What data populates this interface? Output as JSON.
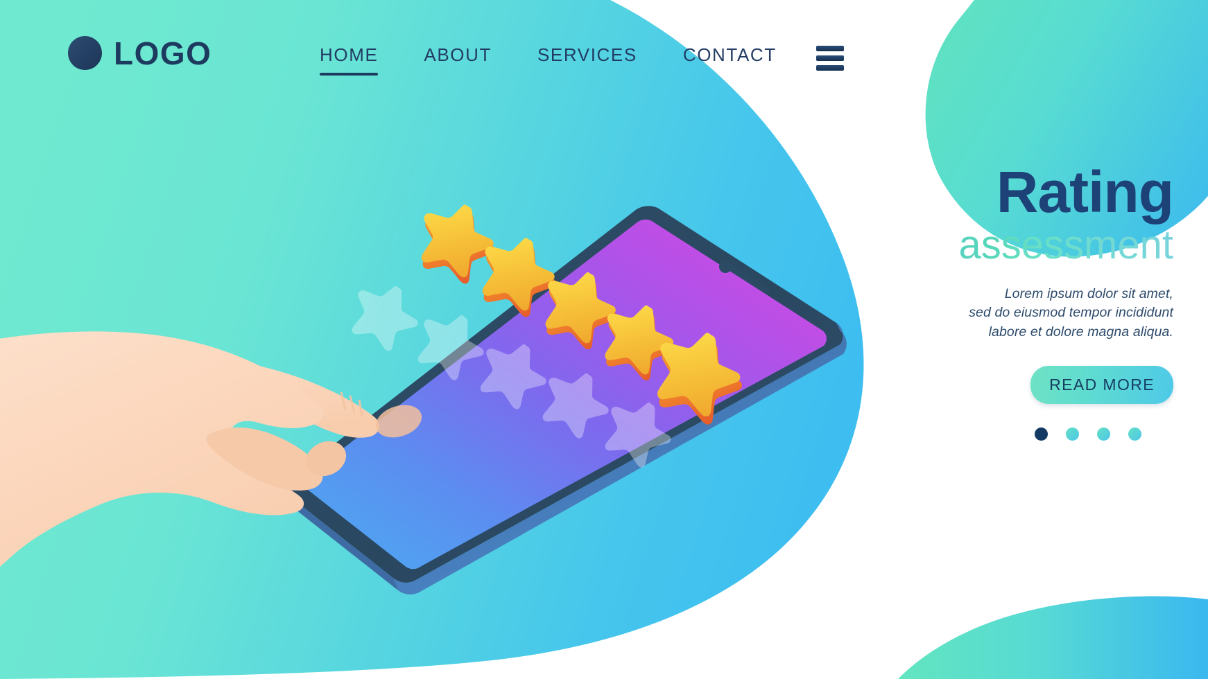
{
  "brand": {
    "logo_icon": "circle-logo-mark",
    "name": "LOGO"
  },
  "nav": {
    "items": [
      {
        "label": "HOME",
        "active": true
      },
      {
        "label": "ABOUT",
        "active": false
      },
      {
        "label": "SERVICES",
        "active": false
      },
      {
        "label": "CONTACT",
        "active": false
      }
    ],
    "menu_icon": "hamburger-menu-icon"
  },
  "hero": {
    "title": "Rating",
    "subtitle": "assessment",
    "paragraph_lines": [
      "Lorem ipsum dolor sit amet,",
      "sed do eiusmod tempor incididunt",
      "labore et dolore magna aliqua."
    ],
    "cta_label": "READ MORE",
    "carousel": {
      "total": 4,
      "active_index": 0
    }
  },
  "illustration": {
    "name": "hand-tapping-smartphone-star-rating",
    "filled_stars": 5,
    "ghost_stars": 5,
    "device_icon": "smartphone-isometric",
    "hand_icon": "pointing-hand-icon"
  },
  "colors": {
    "mint": "#6fe9cf",
    "teal": "#5fdcd0",
    "sky": "#45c3ea",
    "navy": "#1d3a5f",
    "title_blue": "#1d4277",
    "white": "#ffffff",
    "star_gold": "#f5c33f",
    "star_shadow": "#e8622c",
    "screen_blue": "#4f8ef0",
    "screen_purple": "#9a54e8",
    "screen_magenta": "#cf46e0",
    "bezel": "#2b4a63",
    "skin": "#fbd7bd"
  }
}
